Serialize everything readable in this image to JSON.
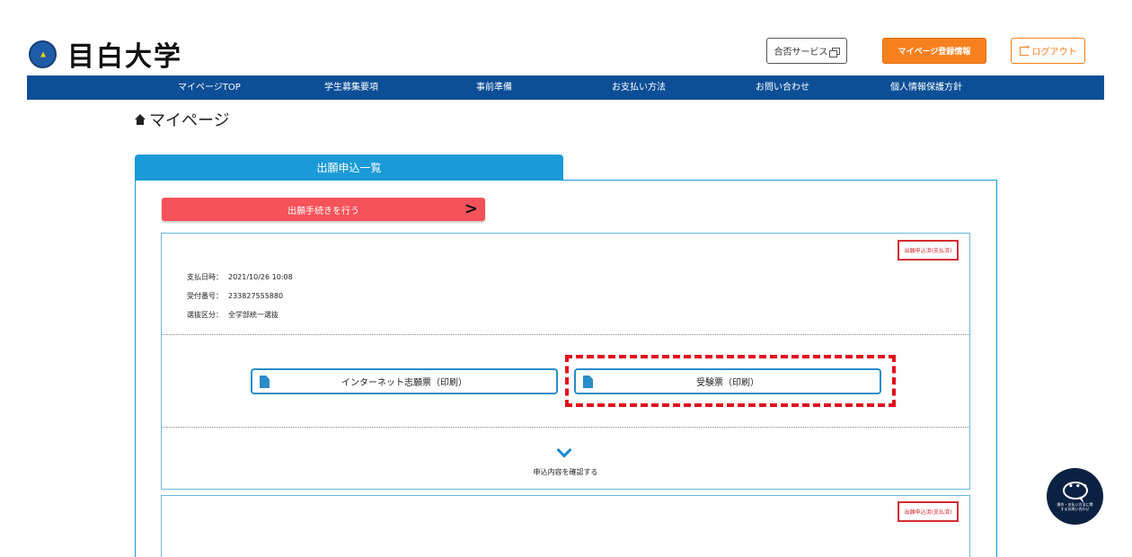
{
  "header": {
    "logo_text": "目白大学",
    "result_service_label": "合否サービス",
    "register_label": "マイページ登録情報",
    "logout_label": "ログアウト"
  },
  "nav": {
    "items": [
      {
        "label": "マイページTOP"
      },
      {
        "label": "学生募集要項"
      },
      {
        "label": "事前準備"
      },
      {
        "label": "お支払い方法"
      },
      {
        "label": "お問い合わせ"
      },
      {
        "label": "個人情報保護方針"
      }
    ]
  },
  "breadcrumb": {
    "title": "マイページ"
  },
  "tab": {
    "label": "出願申込一覧"
  },
  "apply_button": {
    "label": "出願手続きを行う"
  },
  "applications": [
    {
      "status": "出願申込済(支払済)",
      "payment_label": "支払日時：",
      "payment_value": "2021/10/26 10:08",
      "receipt_label": "受付番号：",
      "receipt_value": "233827555880",
      "selection_label": "選抜区分：",
      "selection_value": "全学部統一選抜",
      "print_application_label": "インターネット志願票（印刷）",
      "print_ticket_label": "受験票（印刷）",
      "confirm_label": "申込内容を確認する"
    },
    {
      "status": "出願申込済(支払済)"
    }
  ],
  "chat": {
    "label": "操作・支払い方法に関するお問い合わせ"
  },
  "colors": {
    "nav_bg": "#0c4f97",
    "accent_blue": "#1a9ad6",
    "orange": "#f7801e",
    "apply_red": "#f5525a",
    "highlight_red": "#e0101e"
  }
}
